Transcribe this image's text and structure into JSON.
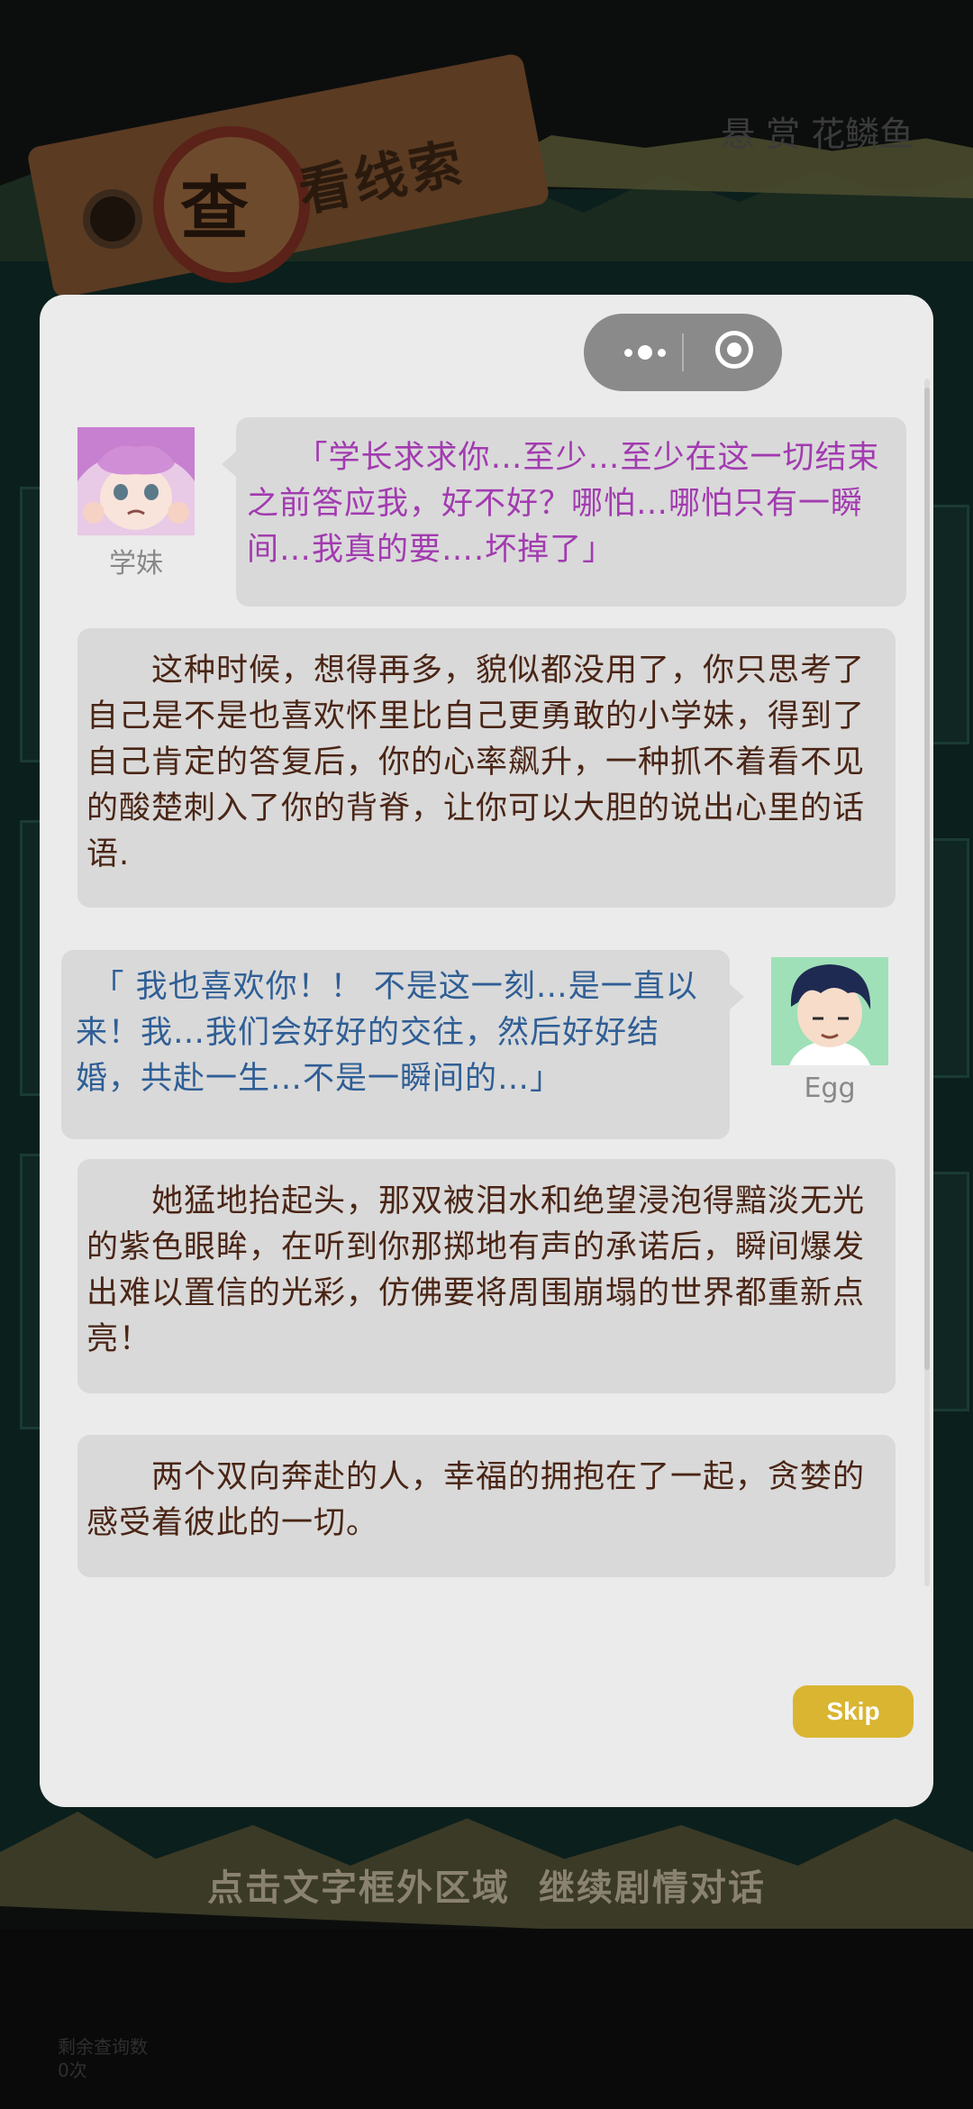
{
  "background": {
    "tag_char": "查",
    "tag_text": "看线索",
    "header_right": "悬 赏 花鳞鱼",
    "bottom_left": "剩余查询数\n0次"
  },
  "capsule": {
    "more_icon": "more-dots-icon",
    "close_icon": "target-circle-icon"
  },
  "dialogs": [
    {
      "type": "character",
      "side": "left",
      "speaker": "学妹",
      "text": "　　「学长求求你…至少…至少在这一切结束之前答应我，好不好？哪怕…哪怕只有一瞬间…我真的要….坏掉了」",
      "color": "#a23bb0"
    },
    {
      "type": "narration",
      "text": "　　这种时候，想得再多，貌似都没用了，你只思考了自己是不是也喜欢怀里比自己更勇敢的小学妹，得到了自己肯定的答复后，你的心率飙升，一种抓不着看不见的酸楚刺入了你的背脊，让你可以大胆的说出心里的话语."
    },
    {
      "type": "character",
      "side": "right",
      "speaker": "Egg",
      "text": "　「 我也喜欢你！！ 不是这一刻…是一直以来！我…我们会好好的交往，然后好好结婚，共赴一生…不是一瞬间的…」",
      "color": "#2f5e95"
    },
    {
      "type": "narration",
      "text": "　　她猛地抬起头，那双被泪水和绝望浸泡得黯淡无光的紫色眼眸，在听到你那掷地有声的承诺后，瞬间爆发出难以置信的光彩，仿佛要将周围崩塌的世界都重新点亮！"
    },
    {
      "type": "narration",
      "text": "　　两个双向奔赴的人，幸福的拥抱在了一起，贪婪的感受着彼此的一切。"
    }
  ],
  "skip_label": "Skip",
  "hint": "点击文字框外区域  继续剧情对话",
  "colors": {
    "narration": "#4a2515",
    "skip": "#d9b532",
    "panel": "#ebebeb",
    "bubble": "#d9d9d9"
  }
}
